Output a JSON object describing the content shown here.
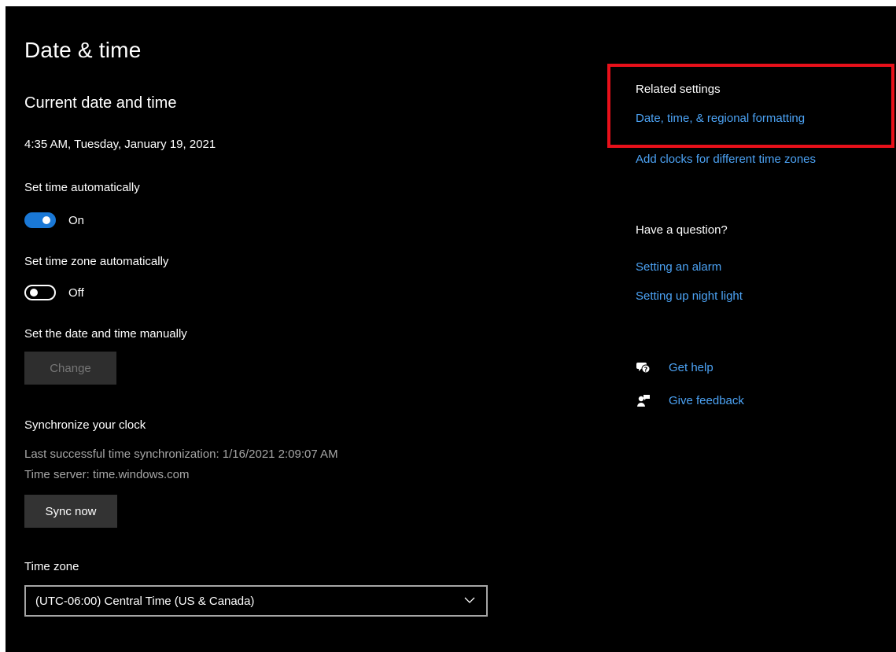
{
  "page": {
    "title": "Date & time"
  },
  "current": {
    "heading": "Current date and time",
    "datetime": "4:35 AM, Tuesday, January 19, 2021"
  },
  "auto_time": {
    "label": "Set time automatically",
    "state": "On",
    "enabled": true
  },
  "auto_zone": {
    "label": "Set time zone automatically",
    "state": "Off",
    "enabled": false
  },
  "manual": {
    "label": "Set the date and time manually",
    "button_label": "Change"
  },
  "sync": {
    "heading": "Synchronize your clock",
    "last_sync": "Last successful time synchronization: 1/16/2021 2:09:07 AM",
    "server": "Time server: time.windows.com",
    "button_label": "Sync now"
  },
  "timezone": {
    "label": "Time zone",
    "selected": "(UTC-06:00) Central Time (US & Canada)"
  },
  "related": {
    "heading": "Related settings",
    "links": [
      "Date, time, & regional formatting",
      "Add clocks for different time zones"
    ]
  },
  "question": {
    "heading": "Have a question?",
    "links": [
      "Setting an alarm",
      "Setting up night light"
    ]
  },
  "help": {
    "get_help": "Get help",
    "give_feedback": "Give feedback"
  },
  "colors": {
    "background": "#000000",
    "accent": "#1a78d6",
    "link": "#4ca3f5",
    "highlight": "#e8101a"
  },
  "icons": [
    "get-help-icon",
    "give-feedback-icon",
    "chevron-down-icon"
  ]
}
